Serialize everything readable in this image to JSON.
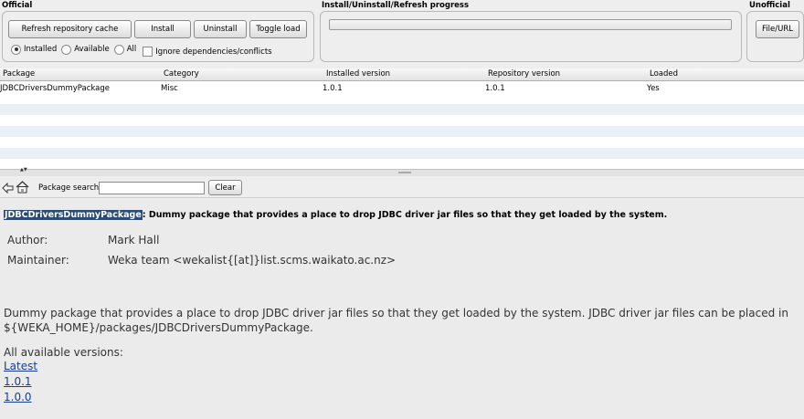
{
  "official": {
    "title": "Official",
    "buttons": {
      "refresh": "Refresh repository cache",
      "install": "Install",
      "uninstall": "Uninstall",
      "toggle_load": "Toggle load"
    },
    "filter": {
      "installed": "Installed",
      "available": "Available",
      "all": "All",
      "selected": "Installed"
    },
    "ignore_deps": "Ignore dependencies/conflicts"
  },
  "progress": {
    "title": "Install/Uninstall/Refresh progress"
  },
  "unofficial": {
    "title": "Unofficial",
    "file_url": "File/URL"
  },
  "table": {
    "columns": [
      "Package",
      "Category",
      "Installed version",
      "Repository version",
      "Loaded"
    ],
    "rows": [
      {
        "package": "JDBCDriversDummyPackage",
        "category": "Misc",
        "installed": "1.0.1",
        "repository": "1.0.1",
        "loaded": "Yes"
      }
    ]
  },
  "toolbar": {
    "search_label": "Package search",
    "search_value": "",
    "clear": "Clear"
  },
  "detail": {
    "name": "JDBCDriversDummyPackage",
    "summary": ": Dummy package that provides a place to drop JDBC driver jar files so that they get loaded by the system.",
    "author_label": "Author:",
    "author": "Mark Hall",
    "maintainer_label": "Maintainer:",
    "maintainer": "Weka team <wekalist{[at]}list.scms.waikato.ac.nz>",
    "description": "Dummy package that provides a place to drop JDBC driver jar files so that they get loaded by the system. JDBC driver jar files can be placed in ${WEKA_HOME}/packages/JDBCDriversDummyPackage.",
    "versions_label": "All available versions:",
    "versions": [
      "Latest",
      "1.0.1",
      "1.0.0"
    ]
  }
}
